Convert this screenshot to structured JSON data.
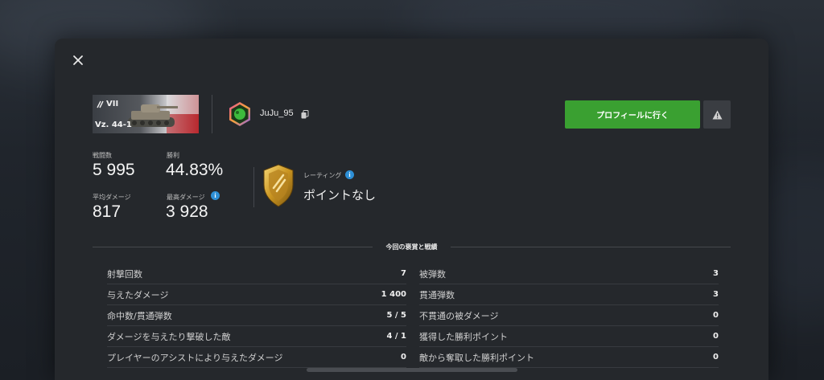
{
  "vehicle": {
    "tier": "VII",
    "name": "Vz. 44-1"
  },
  "player": {
    "name": "JuJu_95"
  },
  "buttons": {
    "profile": "プロフィールに行く",
    "close": "✕"
  },
  "stats": {
    "battles_label": "戦闘数",
    "battles_value": "5 995",
    "winrate_label": "勝利",
    "winrate_value": "44.83%",
    "avg_damage_label": "平均ダメージ",
    "avg_damage_value": "817",
    "max_damage_label": "最高ダメージ",
    "max_damage_value": "3 928"
  },
  "rating": {
    "label": "レーティング",
    "value": "ポイントなし"
  },
  "section_title": "今回の褒賞と戦績",
  "battle_stats": {
    "left": [
      {
        "label": "射撃回数",
        "value": "7"
      },
      {
        "label": "与えたダメージ",
        "value": "1 400"
      },
      {
        "label": "命中数/貫通弾数",
        "value": "5 / 5"
      },
      {
        "label": "ダメージを与えたり撃破した敵",
        "value": "4 / 1"
      },
      {
        "label": "プレイヤーのアシストにより与えたダメージ",
        "value": "0"
      }
    ],
    "right": [
      {
        "label": "被弾数",
        "value": "3"
      },
      {
        "label": "貫通弾数",
        "value": "3"
      },
      {
        "label": "不貫通の被ダメージ",
        "value": "0"
      },
      {
        "label": "獲得した勝利ポイント",
        "value": "0"
      },
      {
        "label": "敵から奪取した勝利ポイント",
        "value": "0"
      }
    ]
  },
  "colors": {
    "accent_green": "#3aa031",
    "info_blue": "#2d8fd6",
    "rating_gold": "#d4a62a"
  }
}
